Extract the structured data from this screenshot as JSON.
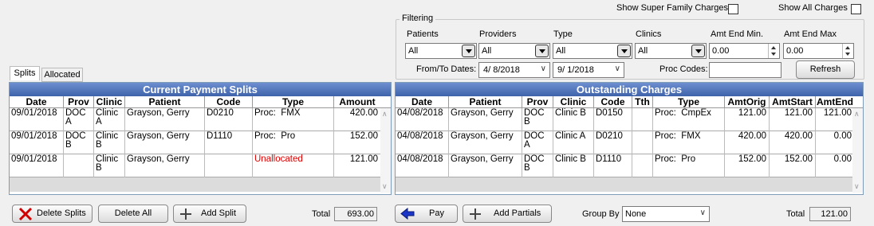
{
  "top": {
    "show_super_family": "Show Super Family Charges",
    "show_all": "Show All Charges"
  },
  "filtering": {
    "legend": "Filtering",
    "patients_label": "Patients",
    "providers_label": "Providers",
    "type_label": "Type",
    "clinics_label": "Clinics",
    "amt_min_label": "Amt End Min.",
    "amt_max_label": "Amt End Max",
    "patients_value": "All",
    "providers_value": "All",
    "type_value": "All",
    "clinics_value": "All",
    "amt_min_value": "0.00",
    "amt_max_value": "0.00",
    "dates_label": "From/To Dates:",
    "date_from": "4/  8/2018",
    "date_to": "9/  1/2018",
    "proc_codes_label": "Proc Codes:",
    "proc_codes_value": "",
    "refresh": "Refresh"
  },
  "tabs": [
    "Splits",
    "Allocated"
  ],
  "splits": {
    "title": "Current Payment Splits",
    "headers": [
      "Date",
      "Prov",
      "Clinic",
      "Patient",
      "Code",
      "Type",
      "Amount"
    ],
    "rows": [
      [
        "09/01/2018",
        "DOC A",
        "Clinic A",
        "Grayson, Gerry",
        "D0210",
        "Proc:  FMX",
        "420.00"
      ],
      [
        "09/01/2018",
        "DOC B",
        "Clinic B",
        "Grayson, Gerry",
        "D1110",
        "Proc:  Pro",
        "152.00"
      ],
      [
        "09/01/2018",
        "",
        "Clinic B",
        "Grayson, Gerry",
        "",
        "Unallocated",
        "121.00"
      ]
    ],
    "unallocated_color": "#e00000"
  },
  "outstanding": {
    "title": "Outstanding Charges",
    "headers": [
      "Date",
      "Patient",
      "Prov",
      "Clinic",
      "Code",
      "Tth",
      "Type",
      "AmtOrig",
      "AmtStart",
      "AmtEnd"
    ],
    "rows": [
      [
        "04/08/2018",
        "Grayson, Gerry",
        "DOC B",
        "Clinic B",
        "D0150",
        "",
        "Proc:  CmpEx",
        "121.00",
        "121.00",
        "121.00"
      ],
      [
        "04/08/2018",
        "Grayson, Gerry",
        "DOC A",
        "Clinic A",
        "D0210",
        "",
        "Proc:  FMX",
        "420.00",
        "420.00",
        "0.00"
      ],
      [
        "04/08/2018",
        "Grayson, Gerry",
        "DOC B",
        "Clinic B",
        "D1110",
        "",
        "Proc:  Pro",
        "152.00",
        "152.00",
        "0.00"
      ]
    ]
  },
  "bottom": {
    "delete_splits": "Delete Splits",
    "delete_all": "Delete All",
    "add_split": "Add Split",
    "total_label": "Total",
    "splits_total": "693.00",
    "pay": "Pay",
    "add_partials": "Add Partials",
    "group_by_label": "Group By",
    "group_by_value": "None",
    "charges_total": "121.00"
  }
}
